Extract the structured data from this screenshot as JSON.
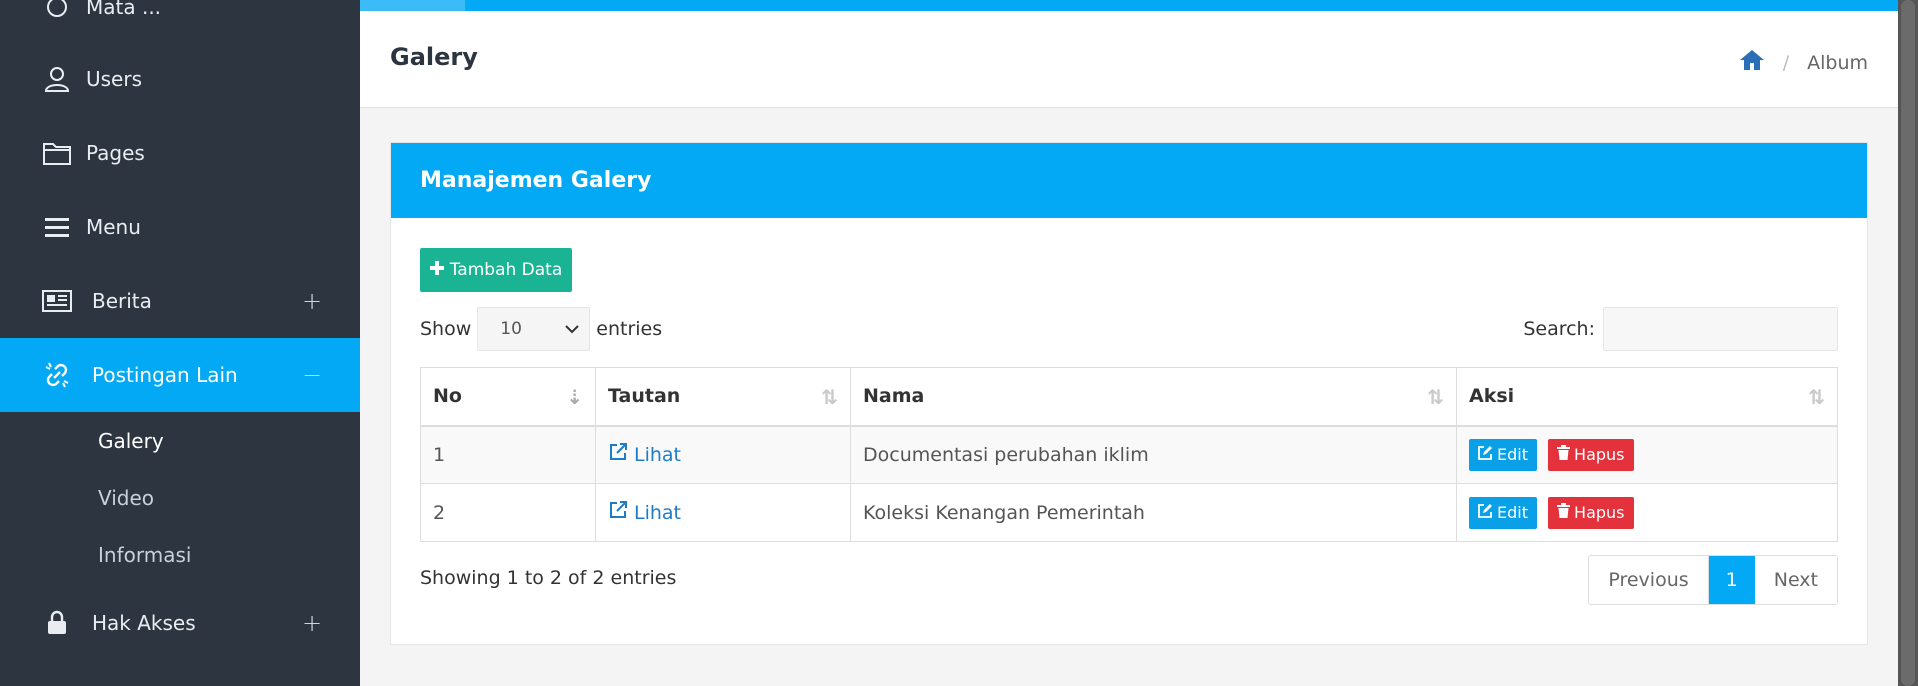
{
  "sidebar": {
    "items": [
      {
        "label": "Mata ..."
      },
      {
        "label": "Users"
      },
      {
        "label": "Pages"
      },
      {
        "label": "Menu"
      },
      {
        "label": "Berita",
        "sign": "+"
      },
      {
        "label": "Postingan Lain",
        "sign": "−"
      },
      {
        "label": "Hak Akses",
        "sign": "+"
      }
    ],
    "subitems": [
      {
        "label": "Galery"
      },
      {
        "label": "Video"
      },
      {
        "label": "Informasi"
      }
    ]
  },
  "header": {
    "title": "Galery",
    "breadcrumb": {
      "separator": "/",
      "current": "Album"
    }
  },
  "card": {
    "title": "Manajemen Galery",
    "add_button": "Tambah Data",
    "show_label": "Show",
    "entries_label": "entries",
    "page_length": "10",
    "search_label": "Search:",
    "search_value": ""
  },
  "table": {
    "headers": [
      "No",
      "Tautan",
      "Nama",
      "Aksi"
    ],
    "rows": [
      {
        "no": "1",
        "link": "Lihat",
        "nama": "Documentasi perubahan iklim",
        "edit": "Edit",
        "hapus": "Hapus"
      },
      {
        "no": "2",
        "link": "Lihat",
        "nama": "Koleksi Kenangan Pemerintah",
        "edit": "Edit",
        "hapus": "Hapus"
      }
    ]
  },
  "footer": {
    "info": "Showing 1 to 2 of 2 entries",
    "previous": "Previous",
    "current_page": "1",
    "next": "Next"
  },
  "colors": {
    "sidebar": "#2d3540",
    "accent": "#03a9f4",
    "add_button": "#1ab394",
    "delete_button": "#e3323c"
  }
}
